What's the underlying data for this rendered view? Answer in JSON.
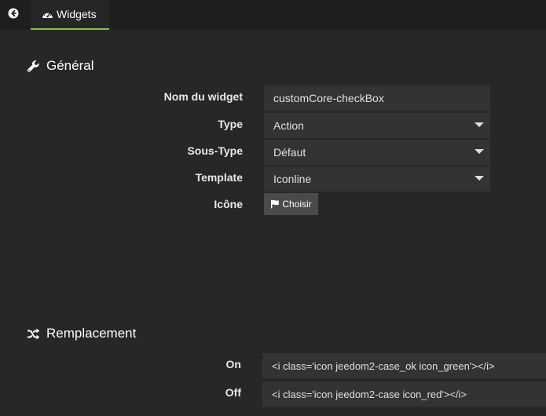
{
  "topbar": {
    "back_icon": "arrow-circle-left-icon",
    "tab": {
      "icon": "dashboard-gauge-icon",
      "label": "Widgets"
    }
  },
  "general": {
    "title": "Général",
    "icon": "wrench-icon",
    "fields": {
      "name": {
        "label": "Nom du widget",
        "value": "customCore-checkBox"
      },
      "type": {
        "label": "Type",
        "value": "Action"
      },
      "subtype": {
        "label": "Sous-Type",
        "value": "Défaut"
      },
      "template": {
        "label": "Template",
        "value": "Iconline"
      },
      "icon": {
        "label": "Icône",
        "button_label": "Choisir",
        "button_icon": "flag-icon"
      }
    }
  },
  "replacement": {
    "title": "Remplacement",
    "icon": "random-shuffle-icon",
    "rows": {
      "on": {
        "label": "On",
        "value": "<i class='icon jeedom2-case_ok icon_green'></i>"
      },
      "off": {
        "label": "Off",
        "value": "<i class='icon jeedom2-case icon_red'></i>"
      }
    }
  },
  "colors": {
    "background": "#272727",
    "topbar": "#1e1e1e",
    "field_bg": "#333333",
    "tab_accent": "#8fbf3b"
  }
}
